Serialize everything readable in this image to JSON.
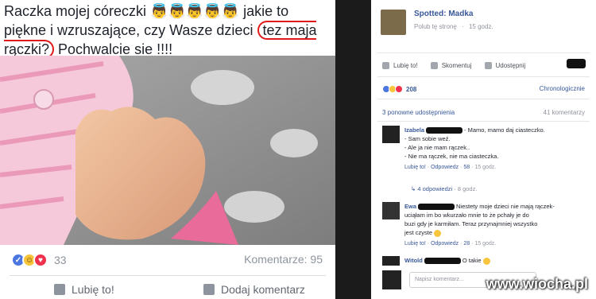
{
  "left_post": {
    "text_before": "Raczka mojej córeczki 👼👼👼👼👼 jakie to piękne i wzruszające, czy Wasze dzieci ",
    "text_highlight": "tez maja rączki?",
    "text_after": " Pochwalcie sie !!!!",
    "reaction_count": "33",
    "comments_label": "Komentarze: 95",
    "like_label": "Lubię to!",
    "comment_label": "Dodaj komentarz"
  },
  "right_post": {
    "page_name": "Spotted: Madka",
    "page_like_label": "Polub tę stronę",
    "time": "15 godz.",
    "actions": [
      "Lubię to!",
      "Skomentuj",
      "Udostępnij"
    ],
    "reaction_count": "208",
    "sort_label": "Chronologicznie",
    "shares_label": "3 ponowne udostępnienia",
    "comments_count_label": "41 komentarzy",
    "comments": [
      {
        "author": "Izabela",
        "lines": [
          "- Mamo, mamo daj ciasteczko.",
          "- Sam sobie weź.",
          "- Ale ja nie mam rączek..",
          "- Nie ma rączek, nie ma ciasteczka."
        ],
        "meta_like": "Lubię to!",
        "meta_reply": "Odpowiedz",
        "meta_likes": "58",
        "meta_time": "15 godz."
      },
      {
        "author": "Ewa",
        "lines": [
          "Niestety moje dzieci nie mają rączek-",
          "uciąłam im bo wkurzało mnie to że pchały je do",
          "buzi gdy je karmiłam. Teraz przynajmniej wszystko",
          "jest czyste"
        ],
        "meta_like": "Lubię to!",
        "meta_reply": "Odpowiedz",
        "meta_likes": "28",
        "meta_time": "15 godz."
      },
      {
        "author": "Witold",
        "lines": [
          "O takie"
        ]
      }
    ],
    "replies_label": "4 odpowiedzi",
    "replies_time": "8 godz.",
    "reply_placeholder": "Napisz komentarz..."
  },
  "watermark": "www.wiocha.pl"
}
